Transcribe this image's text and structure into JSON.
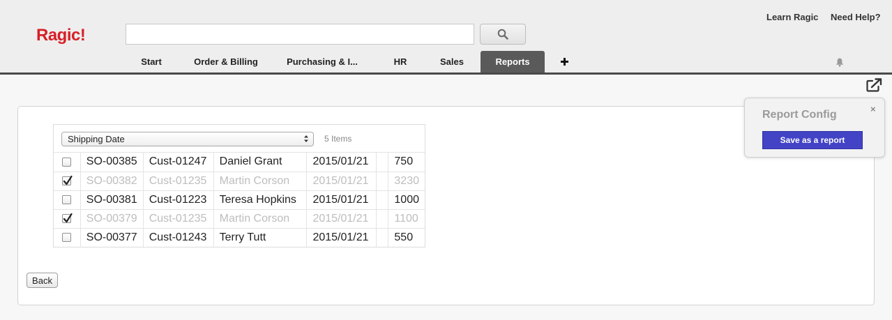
{
  "header": {
    "logo": "Ragic!",
    "search": {
      "value": "",
      "placeholder": ""
    },
    "links": {
      "learn": "Learn Ragic",
      "help": "Need Help?"
    },
    "tabs": [
      {
        "label": "Start"
      },
      {
        "label": "Order & Billing"
      },
      {
        "label": "Purchasing & I..."
      },
      {
        "label": "HR"
      },
      {
        "label": "Sales"
      },
      {
        "label": "Reports",
        "active": true
      }
    ],
    "add_tab": "+"
  },
  "list": {
    "group_by": "Shipping Date",
    "count": "5 Items",
    "rows": [
      {
        "checked": false,
        "so": "SO-00385",
        "cust": "Cust-01247",
        "name": "Daniel Grant",
        "date": "2015/01/21",
        "extra": "",
        "amount": "750"
      },
      {
        "checked": true,
        "so": "SO-00382",
        "cust": "Cust-01235",
        "name": "Martin Corson",
        "date": "2015/01/21",
        "extra": "",
        "amount": "3230"
      },
      {
        "checked": false,
        "so": "SO-00381",
        "cust": "Cust-01223",
        "name": "Teresa Hopkins",
        "date": "2015/01/21",
        "extra": "",
        "amount": "1000"
      },
      {
        "checked": true,
        "so": "SO-00379",
        "cust": "Cust-01235",
        "name": "Martin Corson",
        "date": "2015/01/21",
        "extra": "",
        "amount": "1100"
      },
      {
        "checked": false,
        "so": "SO-00377",
        "cust": "Cust-01243",
        "name": "Terry Tutt",
        "date": "2015/01/21",
        "extra": "",
        "amount": "550"
      }
    ]
  },
  "back_label": "Back",
  "report_config": {
    "title": "Report Config",
    "close": "×",
    "save_label": "Save as a report"
  },
  "colors": {
    "logo": "#d71f26",
    "active_tab": "#5a5a5a",
    "primary_button": "#4243c5"
  },
  "icons": {
    "search": "search-icon",
    "bell": "bell-icon",
    "external": "external-link-icon",
    "select": "select-arrows-icon",
    "check": "check-icon"
  }
}
